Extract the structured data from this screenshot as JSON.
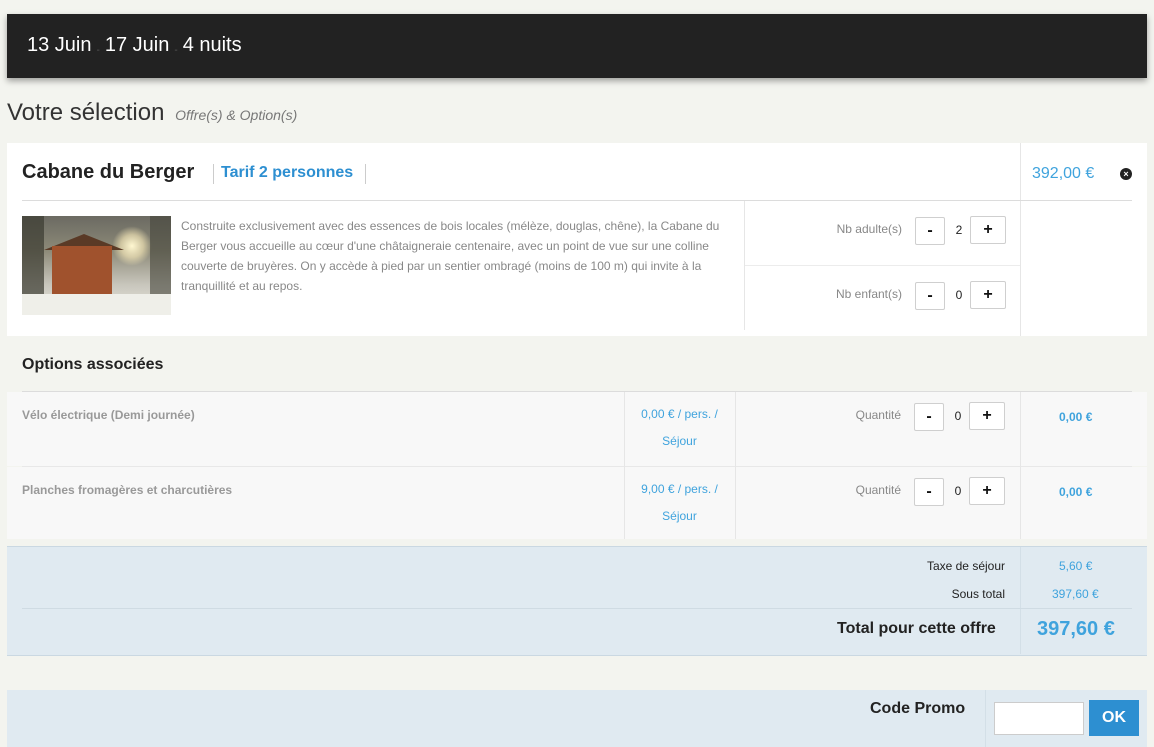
{
  "header": {
    "date_start": "13 Juin",
    "date_end": "17 Juin",
    "nights": "4 nuits"
  },
  "selection": {
    "title": "Votre sélection",
    "subtitle": "Offre(s) & Option(s)"
  },
  "offer": {
    "name": "Cabane du Berger",
    "tarif": "Tarif 2 personnes",
    "price": "392,00 €",
    "close_icon": "close-circle-icon",
    "image_icon": "cabin-photo",
    "description": "Construite exclusivement avec des essences de bois locales (mélèze, douglas, chêne), la Cabane du Berger vous accueille au cœur d'une châtaigneraie centenaire, avec un point de vue sur une colline couverte de bruyères. On y accède à pied par un sentier ombragé (moins de 100 m) qui invite à la tranquillité et au repos.",
    "adults_label": "Nb adulte(s)",
    "adults_value": "2",
    "children_label": "Nb enfant(s)",
    "children_value": "0",
    "minus": "-",
    "plus": "+"
  },
  "options": {
    "title": "Options associées",
    "items": [
      {
        "name": "Vélo électrique (Demi journée)",
        "price": "0,00 € / pers. / Séjour",
        "qty_label": "Quantité",
        "qty": "0",
        "total": "0,00 €"
      },
      {
        "name": "Planches fromagères et charcutières",
        "price": "9,00 € / pers. / Séjour",
        "qty_label": "Quantité",
        "qty": "0",
        "total": "0,00 €"
      }
    ]
  },
  "totals": {
    "tax_label": "Taxe de séjour",
    "tax_value": "5,60 €",
    "subtotal_label": "Sous total",
    "subtotal_value": "397,60 €",
    "total_label": "Total pour cette offre",
    "total_value": "397,60 €"
  },
  "promo": {
    "label": "Code Promo",
    "input_value": "",
    "button": "OK"
  },
  "colors": {
    "accent": "#2d8fd1",
    "price": "#3fa3dd",
    "header_bg": "#222222",
    "totals_bg": "#e0eaf1"
  }
}
